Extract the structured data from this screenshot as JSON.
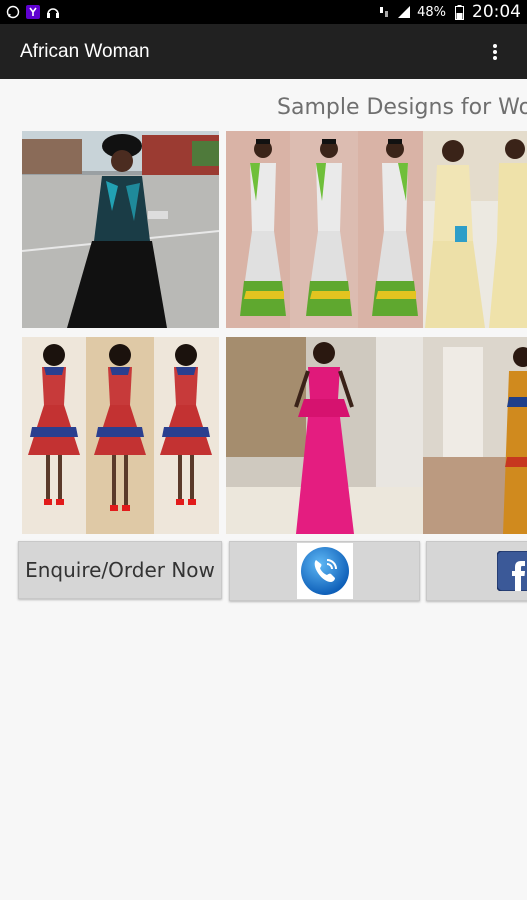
{
  "status_bar": {
    "battery_percent": "48%",
    "time": "20:04",
    "icons": [
      "whatsapp-icon",
      "yahoo-icon",
      "headphones-icon",
      "data-transfer-icon",
      "signal-icon",
      "battery-icon"
    ]
  },
  "app_bar": {
    "title": "African Woman",
    "menu_icon": "overflow-menu-icon"
  },
  "main": {
    "heading": "Sample Designs for Wom",
    "gallery_rows": [
      [
        "photo-black-teal-gown",
        "photo-print-mermaid-dresses",
        "photo-cream-lace-gowns"
      ],
      [
        "photo-print-skater-dresses",
        "photo-pink-peplum-gown",
        "photo-print-gown-partial"
      ]
    ],
    "actions": {
      "enquire_label": "Enquire/Order Now",
      "call_icon": "phone-call-icon",
      "facebook_icon": "facebook-icon"
    }
  },
  "colors": {
    "status_bar": "#000000",
    "app_bar": "#212121",
    "background": "#f7f7f7",
    "button": "#d6d6d6",
    "pink_dress": "#e0197a",
    "facebook_blue": "#3b5998"
  }
}
